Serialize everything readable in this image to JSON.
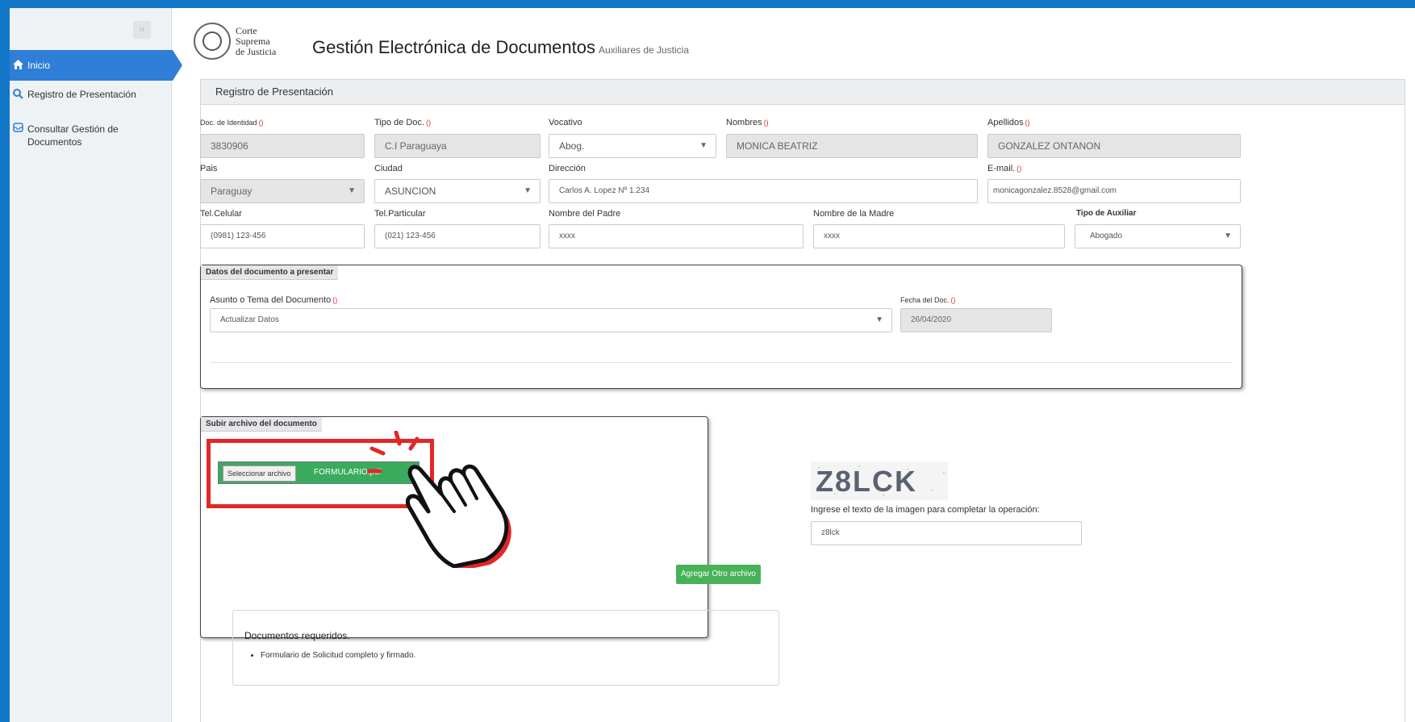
{
  "sidebar": {
    "items": [
      {
        "label": "Inicio",
        "icon": "home-icon"
      },
      {
        "label": "Registro de Presentación",
        "icon": "search-icon"
      },
      {
        "label": "Consultar Gestión de Documentos",
        "icon": "inbox-icon"
      }
    ]
  },
  "header": {
    "logo_line1": "Corte",
    "logo_line2": "Suprema",
    "logo_line3": "de Justicia",
    "title": "Gestión Electrónica de Documentos",
    "subtitle": "Auxiliares de Justicia"
  },
  "panel": {
    "title": "Registro de Presentación"
  },
  "form": {
    "doc_identidad": {
      "label": "Doc. de Identidad",
      "value": "3830906"
    },
    "tipo_doc": {
      "label": "Tipo de Doc.",
      "value": "C.I Paraguaya"
    },
    "vocativo": {
      "label": "Vocativo",
      "value": "Abog."
    },
    "nombres": {
      "label": "Nombres",
      "value": "MONICA BEATRIZ"
    },
    "apellidos": {
      "label": "Apellidos",
      "value": "GONZALEZ ONTANON"
    },
    "pais": {
      "label": "Pais",
      "value": "Paraguay"
    },
    "ciudad": {
      "label": "Ciudad",
      "value": "ASUNCION"
    },
    "direccion": {
      "label": "Dirección",
      "value": "Carlos A. Lopez Nº 1.234"
    },
    "email": {
      "label": "E-mail.",
      "value": "monicagonzalez.8528@gmail.com"
    },
    "tel_celular": {
      "label": "Tel.Celular",
      "value": "(0981) 123-456"
    },
    "tel_particular": {
      "label": "Tel.Particular",
      "value": "(021) 123-456"
    },
    "nombre_padre": {
      "label": "Nombre del Padre",
      "value": "xxxx"
    },
    "nombre_madre": {
      "label": "Nombre de la Madre",
      "value": "xxxx"
    },
    "tipo_auxiliar": {
      "label": "Tipo de Auxiliar",
      "value": "Abogado"
    }
  },
  "documento": {
    "legend": "Datos del documento a presentar",
    "asunto_label": "Asunto o Tema del Documento",
    "asunto_value": "Actualizar Datos",
    "fecha_label": "Fecha del Doc.",
    "fecha_value": "26/04/2020"
  },
  "archivo": {
    "legend": "Subir archivo del documento",
    "select_label": "Seleccionar archivo",
    "file_name": "FORMULARIO.pdf",
    "add_label": "Agregar Otro archivo",
    "req_title": "Documentos requeridos.",
    "req_items": [
      "Formulario de Solicitud completo y firmado."
    ]
  },
  "captcha": {
    "image_text": "Z8LCK",
    "prompt": "Ingrese el texto de la imagen para completar la operación:",
    "value": "z8lck"
  },
  "req_marker": "()",
  "colors": {
    "accent": "#2f7ed8",
    "background": "#1478c8",
    "success": "#47b258",
    "highlight": "#e32626"
  }
}
